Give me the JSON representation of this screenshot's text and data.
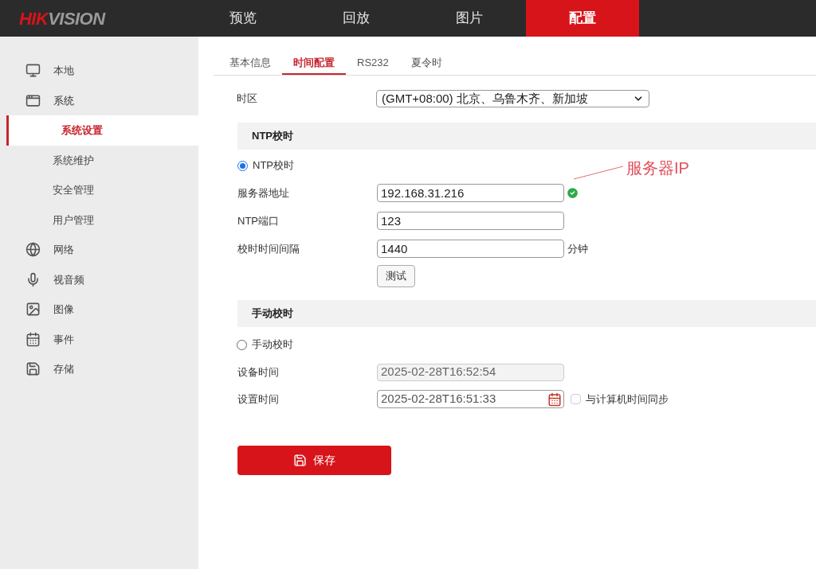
{
  "logo": {
    "primary": "HIK",
    "secondary": "VISION"
  },
  "nav": [
    {
      "label": "预览",
      "selected": false
    },
    {
      "label": "回放",
      "selected": false
    },
    {
      "label": "图片",
      "selected": false
    },
    {
      "label": "配置",
      "selected": true
    }
  ],
  "sidebar": {
    "items": [
      {
        "label": "本地",
        "expanded": false
      },
      {
        "label": "系统",
        "expanded": true,
        "children": [
          {
            "label": "系统设置",
            "selected": true
          },
          {
            "label": "系统维护",
            "selected": false
          },
          {
            "label": "安全管理",
            "selected": false
          },
          {
            "label": "用户管理",
            "selected": false
          }
        ]
      },
      {
        "label": "网络",
        "expanded": false
      },
      {
        "label": "视音频",
        "expanded": false
      },
      {
        "label": "图像",
        "expanded": false
      },
      {
        "label": "事件",
        "expanded": false
      },
      {
        "label": "存储",
        "expanded": false
      }
    ]
  },
  "tabs": [
    {
      "label": "基本信息",
      "selected": false
    },
    {
      "label": "时间配置",
      "selected": true
    },
    {
      "label": "RS232",
      "selected": false
    },
    {
      "label": "夏令时",
      "selected": false
    }
  ],
  "timezone": {
    "label": "时区",
    "value": "(GMT+08:00) 北京、乌鲁木齐、新加坡"
  },
  "ntp": {
    "title": "NTP校时",
    "radio": {
      "label": "NTP校时",
      "selected": true
    },
    "fields": [
      {
        "label": "服务器地址",
        "value": "192.168.31.216",
        "valid": true
      },
      {
        "label": "NTP端口",
        "value": "123"
      },
      {
        "label": "校时时间间隔",
        "value": "1440",
        "unit": "分钟"
      }
    ],
    "test_button": "测试"
  },
  "manual": {
    "title": "手动校时",
    "radio": {
      "label": "手动校时",
      "selected": false
    },
    "device_time": {
      "label": "设备时间",
      "value": "2025-02-28T16:52:54"
    },
    "set_time": {
      "label": "设置时间",
      "value": "2025-02-28T16:51:33"
    },
    "sync": {
      "label": "与计算机时间同步",
      "checked": false
    }
  },
  "save_button": "保存",
  "annotation": "服务器IP"
}
